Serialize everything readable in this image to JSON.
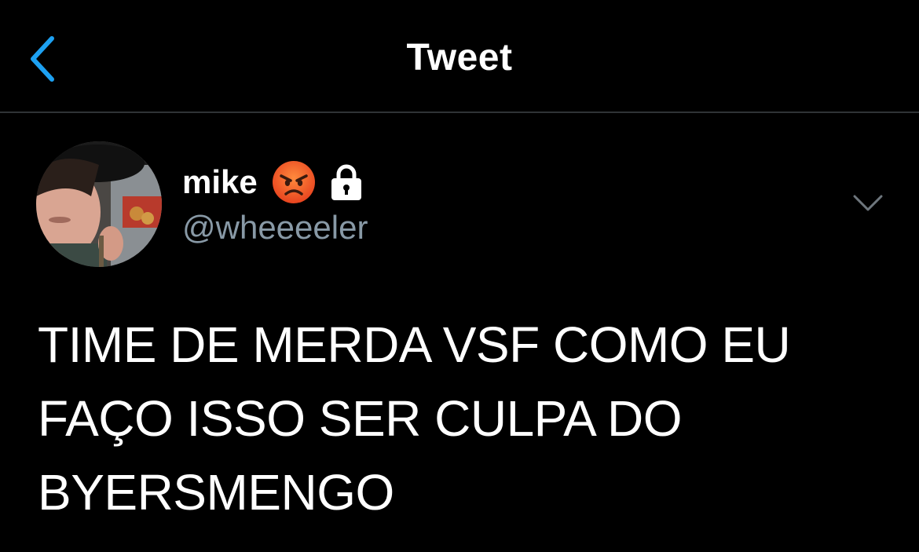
{
  "header": {
    "title": "Tweet",
    "back_icon": "chevron-left-icon",
    "accent_color": "#1da1f2"
  },
  "tweet": {
    "author": {
      "display_name": "mike",
      "emoji_icon": "angry-face-emoji-icon",
      "protected_icon": "lock-icon",
      "handle": "@wheeeeler"
    },
    "menu_icon": "chevron-down-icon",
    "text": "TIME DE MERDA VSF COMO EU FAÇO ISSO SER CULPA DO BYERSMENGO"
  },
  "colors": {
    "background": "#000000",
    "text_primary": "#ffffff",
    "text_secondary": "#8899a6",
    "divider": "#2f3336"
  }
}
